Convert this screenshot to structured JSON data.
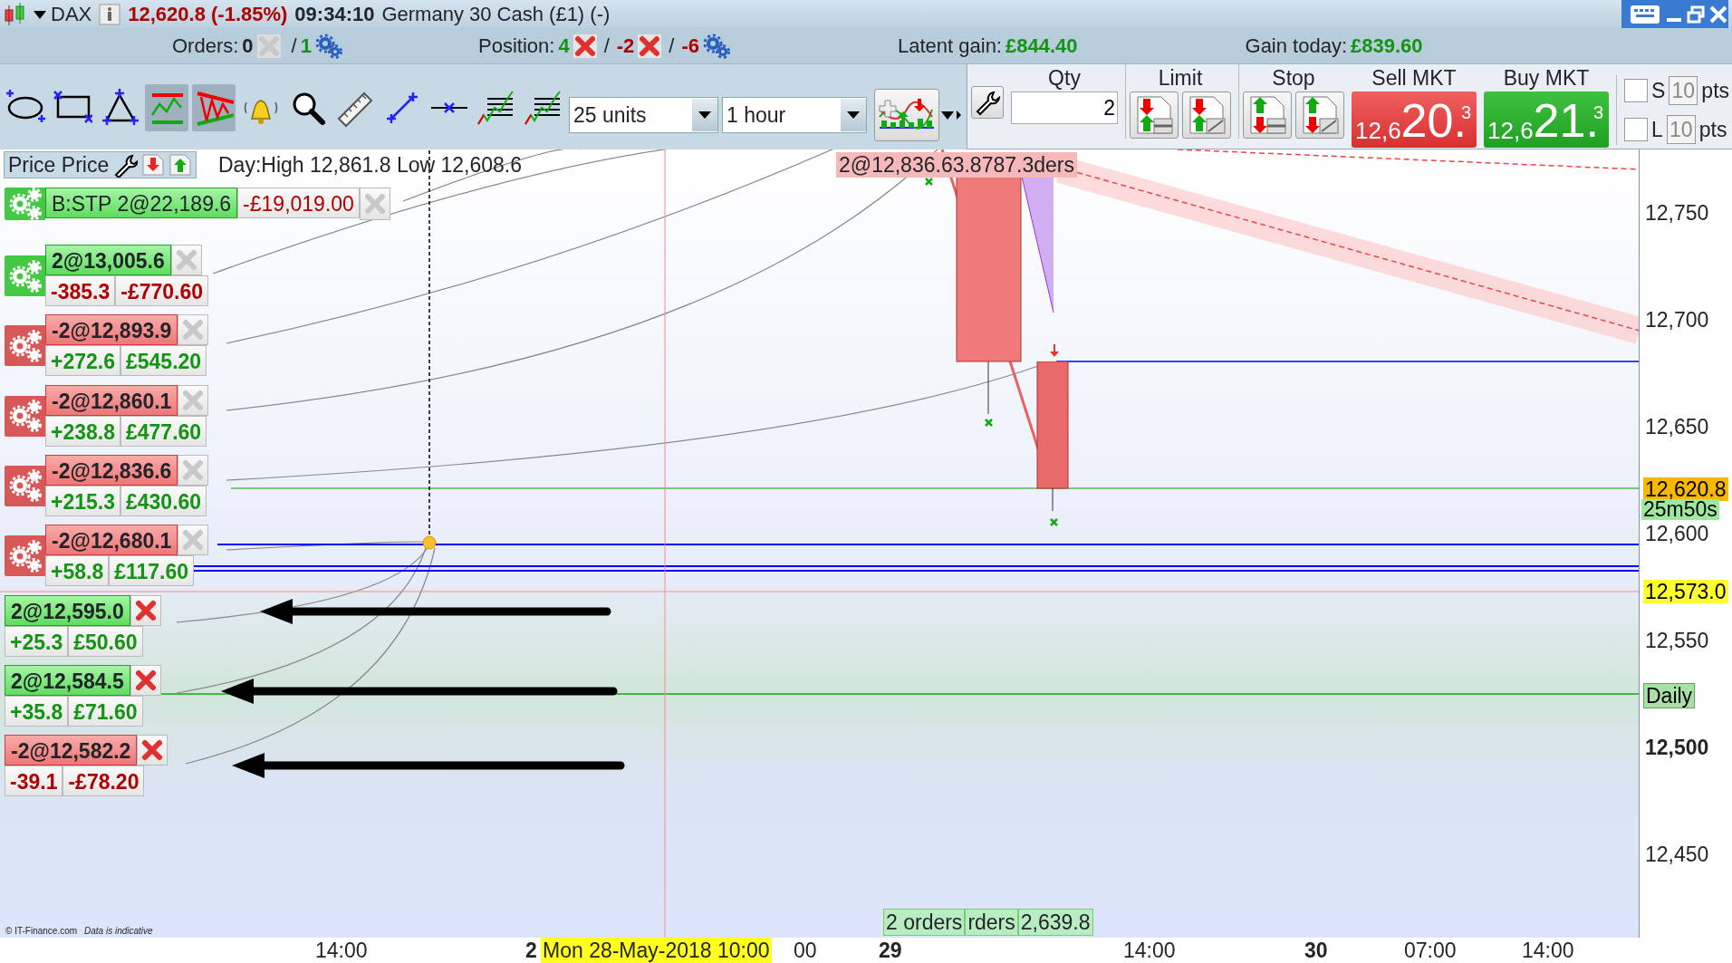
{
  "title_bar": {
    "instrument": "DAX",
    "price_change": "12,620.8 (-1.85%)",
    "time": "09:34:10",
    "description": "Germany 30 Cash (£1) (-)"
  },
  "summary": {
    "orders_label": "Orders:",
    "orders_pending": "0",
    "orders_sep": "/",
    "orders_active": "1",
    "position_label": "Position:",
    "position_values": [
      {
        "text": "4",
        "color": "#139413"
      },
      {
        "text": "-2",
        "color": "#b00000"
      },
      {
        "text": "-6",
        "color": "#b00000"
      }
    ],
    "position_sep": "/",
    "latent_label": "Latent gain:",
    "latent_value": "£844.40",
    "today_label": "Gain today:",
    "today_value": "£839.60"
  },
  "toolbar": {
    "tools": [
      {
        "kind": "ellipse",
        "selected": false
      },
      {
        "kind": "rectangle",
        "selected": false
      },
      {
        "kind": "triangle",
        "selected": false
      },
      {
        "kind": "channel",
        "selected": true
      },
      {
        "kind": "wedge",
        "selected": true
      },
      {
        "kind": "bell",
        "selected": false
      },
      {
        "kind": "magnifier",
        "selected": false
      },
      {
        "kind": "ruler",
        "selected": false
      },
      {
        "kind": "segment",
        "selected": false
      },
      {
        "kind": "hline",
        "selected": false
      },
      {
        "kind": "fib",
        "selected": false
      },
      {
        "kind": "fib",
        "selected": false
      }
    ],
    "units": "25 units",
    "timeframe": "1 hour"
  },
  "order_panel": {
    "qty_label": "Qty",
    "qty": "2",
    "limit_label": "Limit",
    "stop_label": "Stop",
    "sell": {
      "label": "Sell MKT",
      "prefix": "12,6",
      "big": "20.",
      "sup": "3"
    },
    "buy": {
      "label": "Buy MKT",
      "prefix": "12,6",
      "big": "21.",
      "sup": "3"
    },
    "brackets": [
      {
        "label": "S",
        "checked": false,
        "points": "10",
        "unit": "pts"
      },
      {
        "label": "L",
        "checked": false,
        "points": "10",
        "unit": "pts"
      }
    ]
  },
  "chart": {
    "title": "Price Price",
    "day_range": "Day:High 12,861.8 Low 12,608.6",
    "stop_order": {
      "label": "B:STP 2@22,189.6",
      "pnl": "-£19,019.00"
    },
    "positions": [
      {
        "kind": "long",
        "label": "2@13,005.6",
        "points": "-385.3",
        "pnl": "-£770.60",
        "color": "#b00000",
        "gear": true,
        "closable": false
      },
      {
        "kind": "short",
        "label": "-2@12,893.9",
        "points": "+272.6",
        "pnl": "£545.20",
        "color": "#139413",
        "gear": true,
        "closable": false
      },
      {
        "kind": "short",
        "label": "-2@12,860.1",
        "points": "+238.8",
        "pnl": "£477.60",
        "color": "#139413",
        "gear": true,
        "closable": false
      },
      {
        "kind": "short",
        "label": "-2@12,836.6",
        "points": "+215.3",
        "pnl": "£430.60",
        "color": "#139413",
        "gear": true,
        "closable": false
      },
      {
        "kind": "short",
        "label": "-2@12,680.1",
        "points": "+58.8",
        "pnl": "£117.60",
        "color": "#139413",
        "gear": true,
        "closable": false
      },
      {
        "kind": "long",
        "label": "2@12,595.0",
        "points": "+25.3",
        "pnl": "£50.60",
        "color": "#139413",
        "gear": false,
        "closable": true
      },
      {
        "kind": "long",
        "label": "2@12,584.5",
        "points": "+35.8",
        "pnl": "£71.60",
        "color": "#139413",
        "gear": false,
        "closable": true
      },
      {
        "kind": "short",
        "label": "-2@12,582.2",
        "points": "-39.1",
        "pnl": "-£78.20",
        "color": "#b00000",
        "gear": false,
        "closable": true
      }
    ],
    "top_label": "2@12,836.63.8787.3ders",
    "bottom_labels": [
      "2 orders",
      "rders",
      "2,639.8"
    ],
    "copyright": "© IT-Finance.com",
    "disclaimer": "Data is indicative"
  },
  "price_axis": {
    "ticks": [
      {
        "label": "12,750",
        "major": false
      },
      {
        "label": "12,700",
        "major": false
      },
      {
        "label": "12,650",
        "major": false
      },
      {
        "label": "12,600",
        "major": false
      },
      {
        "label": "12,550",
        "major": false
      },
      {
        "label": "12,500",
        "major": true
      },
      {
        "label": "12,450",
        "major": false
      }
    ],
    "markers": [
      {
        "kind": "last",
        "text": "12,620.8"
      },
      {
        "kind": "timer",
        "text": "25m50s"
      },
      {
        "kind": "level",
        "text": "12,573.0"
      },
      {
        "kind": "daily",
        "text": "Daily"
      }
    ]
  },
  "time_axis": {
    "labels": [
      {
        "text": "14:00",
        "major": false
      },
      {
        "text": "2",
        "major": true
      },
      {
        "text": "00",
        "major": false
      },
      {
        "text": "29",
        "major": true
      },
      {
        "text": "14:00",
        "major": false
      },
      {
        "text": "30",
        "major": true
      },
      {
        "text": "07:00",
        "major": false
      },
      {
        "text": "14:00",
        "major": false
      }
    ],
    "cursor_date": "Mon 28-May-2018 10:00"
  }
}
